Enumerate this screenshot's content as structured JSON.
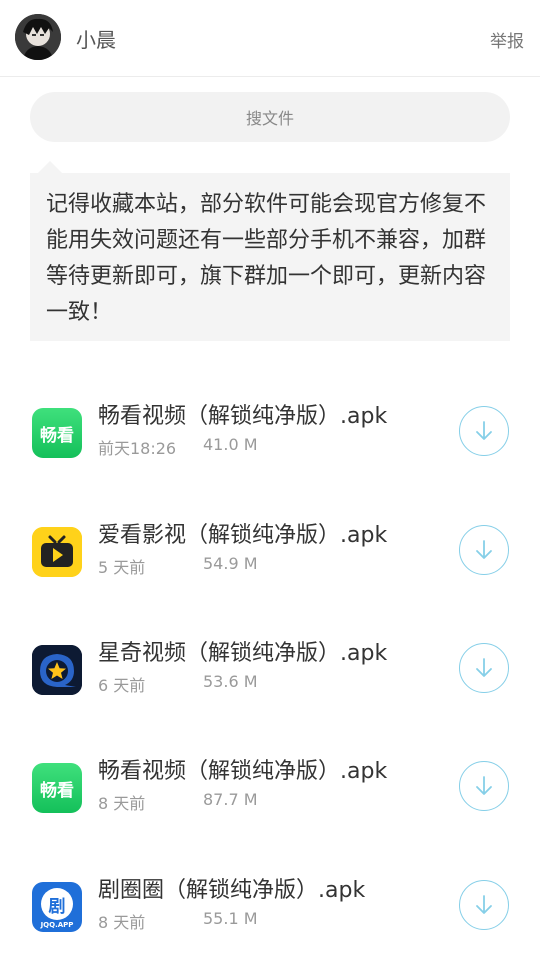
{
  "header": {
    "username": "小晨",
    "report_label": "举报"
  },
  "search": {
    "placeholder": "搜文件"
  },
  "notice": {
    "text": "记得收藏本站，部分软件可能会现官方修复不能用失效问题还有一些部分手机不兼容，加群等待更新即可，旗下群加一个即可，更新内容一致！"
  },
  "files": [
    {
      "name": "畅看视频（解锁纯净版）.apk",
      "time": "前天18:26",
      "size": "41.0 M",
      "icon": "changkan-app-icon",
      "icon_text": "畅看"
    },
    {
      "name": "爱看影视（解锁纯净版）.apk",
      "time": "5 天前",
      "size": "54.9 M",
      "icon": "aikan-tv-app-icon"
    },
    {
      "name": "星奇视频（解锁纯净版）.apk",
      "time": "6 天前",
      "size": "53.6 M",
      "icon": "xingqi-star-app-icon"
    },
    {
      "name": "畅看视频（解锁纯净版）.apk",
      "time": "8 天前",
      "size": "87.7 M",
      "icon": "changkan-app-icon",
      "icon_text": "畅看"
    },
    {
      "name": "剧圈圈（解锁纯净版）.apk",
      "time": "8 天前",
      "size": "55.1 M",
      "icon": "juquanquan-app-icon",
      "icon_text": "剧",
      "icon_subtext": "JQQ.APP"
    }
  ],
  "colors": {
    "accent": "#86cfe8",
    "green_icon": "#1fc864",
    "yellow_icon": "#ffd21a"
  }
}
